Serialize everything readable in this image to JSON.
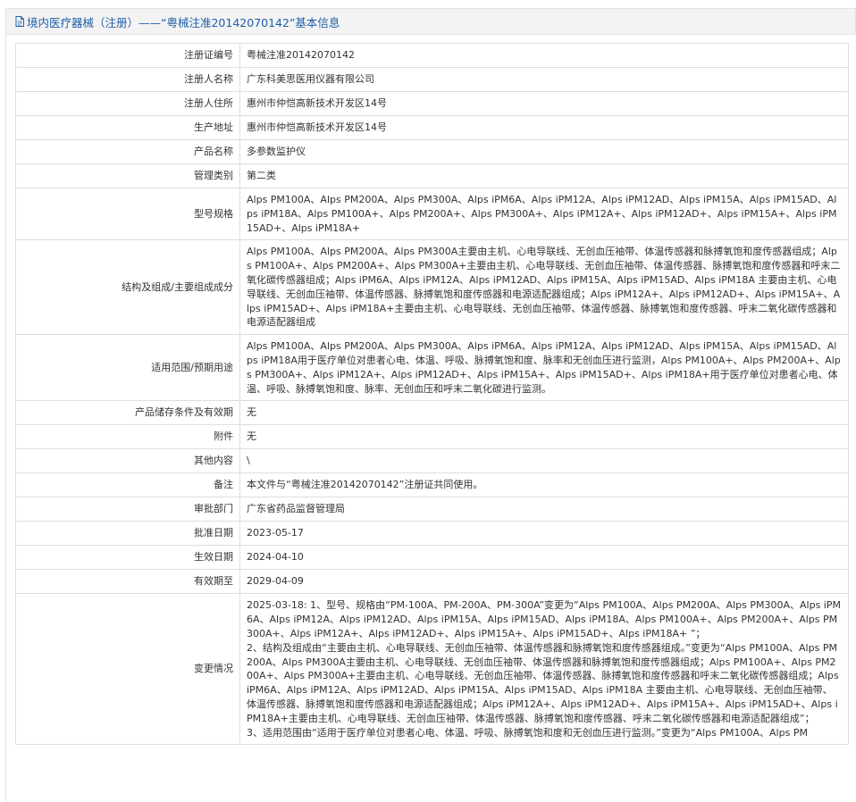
{
  "header": {
    "title": "境内医疗器械（注册）——“粤械注准20142070142”基本信息"
  },
  "rows": [
    {
      "label": "注册证编号",
      "value": [
        "粤械注准20142070142"
      ]
    },
    {
      "label": "注册人名称",
      "value": [
        "广东科美思医用仪器有限公司"
      ]
    },
    {
      "label": "注册人住所",
      "value": [
        "惠州市仲恺高新技术开发区14号"
      ]
    },
    {
      "label": "生产地址",
      "value": [
        "惠州市仲恺高新技术开发区14号"
      ]
    },
    {
      "label": "产品名称",
      "value": [
        "多参数监护仪"
      ]
    },
    {
      "label": "管理类别",
      "value": [
        "第二类"
      ]
    },
    {
      "label": "型号规格",
      "value": [
        "Alps PM100A、Alps PM200A、Alps PM300A、Alps iPM6A、Alps iPM12A、Alps iPM12AD、Alps iPM15A、Alps iPM15AD、Alps iPM18A、Alps PM100A+、Alps PM200A+、Alps PM300A+、Alps iPM12A+、Alps iPM12AD+、Alps iPM15A+、Alps iPM15AD+、Alps iPM18A+"
      ]
    },
    {
      "label": "结构及组成/主要组成成分",
      "value": [
        "Alps PM100A、Alps PM200A、Alps PM300A主要由主机、心电导联线、无创血压袖带、体温传感器和脉搏氧饱和度传感器组成；Alps PM100A+、Alps PM200A+、Alps PM300A+主要由主机、心电导联线、无创血压袖带、体温传感器、脉搏氧饱和度传感器和呼末二氧化碳传感器组成；Alps iPM6A、Alps iPM12A、Alps iPM12AD、Alps iPM15A、Alps iPM15AD、Alps iPM18A 主要由主机、心电导联线、无创血压袖带、体温传感器、脉搏氧饱和度传感器和电源适配器组成；Alps iPM12A+、Alps iPM12AD+、Alps iPM15A+、Alps iPM15AD+、Alps iPM18A+主要由主机、心电导联线、无创血压袖带、体温传感器、脉搏氧饱和度传感器、呼末二氧化碳传感器和电源适配器组成"
      ]
    },
    {
      "label": "适用范围/预期用途",
      "value": [
        "Alps PM100A、Alps PM200A、Alps PM300A、Alps iPM6A、Alps iPM12A、Alps iPM12AD、Alps iPM15A、Alps iPM15AD、Alps iPM18A用于医疗单位对患者心电、体温、呼吸、脉搏氧饱和度、脉率和无创血压进行监测，Alps PM100A+、Alps PM200A+、Alps PM300A+、Alps iPM12A+、Alps iPM12AD+、Alps iPM15A+、Alps iPM15AD+、Alps iPM18A+用于医疗单位对患者心电、体温、呼吸、脉搏氧饱和度、脉率、无创血压和呼末二氧化碳进行监测。"
      ]
    },
    {
      "label": "产品储存条件及有效期",
      "value": [
        "无"
      ]
    },
    {
      "label": "附件",
      "value": [
        "无"
      ]
    },
    {
      "label": "其他内容",
      "value": [
        "\\"
      ]
    },
    {
      "label": "备注",
      "value": [
        "本文件与“粤械注准20142070142”注册证共同使用。"
      ]
    },
    {
      "label": "审批部门",
      "value": [
        "广东省药品监督管理局"
      ]
    },
    {
      "label": "批准日期",
      "value": [
        "2023-05-17"
      ]
    },
    {
      "label": "生效日期",
      "value": [
        "2024-04-10"
      ]
    },
    {
      "label": "有效期至",
      "value": [
        "2029-04-09"
      ]
    },
    {
      "label": "变更情况",
      "value": [
        "2025-03-18: 1、型号、规格由“PM-100A、PM-200A、PM-300A”变更为“Alps PM100A、Alps PM200A、Alps PM300A、Alps iPM6A、Alps iPM12A、Alps iPM12AD、Alps iPM15A、Alps iPM15AD、Alps iPM18A、Alps PM100A+、Alps PM200A+、Alps PM300A+、Alps iPM12A+、Alps iPM12AD+、Alps iPM15A+、Alps iPM15AD+、Alps iPM18A+ ”；",
        "2、结构及组成由“主要由主机、心电导联线、无创血压袖带、体温传感器和脉搏氧饱和度传感器组成。”变更为“Alps PM100A、Alps PM200A、Alps PM300A主要由主机、心电导联线、无创血压袖带、体温传感器和脉搏氧饱和度传感器组成；Alps PM100A+、Alps PM200A+、Alps PM300A+主要由主机、心电导联线、无创血压袖带、体温传感器、脉搏氧饱和度传感器和呼末二氧化碳传感器组成；Alps iPM6A、Alps iPM12A、Alps iPM12AD、Alps iPM15A、Alps iPM15AD、Alps iPM18A 主要由主机、心电导联线、无创血压袖带、体温传感器、脉搏氧饱和度传感器和电源适配器组成；Alps iPM12A+、Alps iPM12AD+、Alps iPM15A+、Alps iPM15AD+、Alps iPM18A+主要由主机、心电导联线、无创血压袖带、体温传感器、脉搏氧饱和度传感器、呼末二氧化碳传感器和电源适配器组成”；",
        "3、适用范围由“适用于医疗单位对患者心电、体温、呼吸、脉搏氧饱和度和无创血压进行监测。”变更为“Alps PM100A、Alps PM"
      ]
    }
  ]
}
